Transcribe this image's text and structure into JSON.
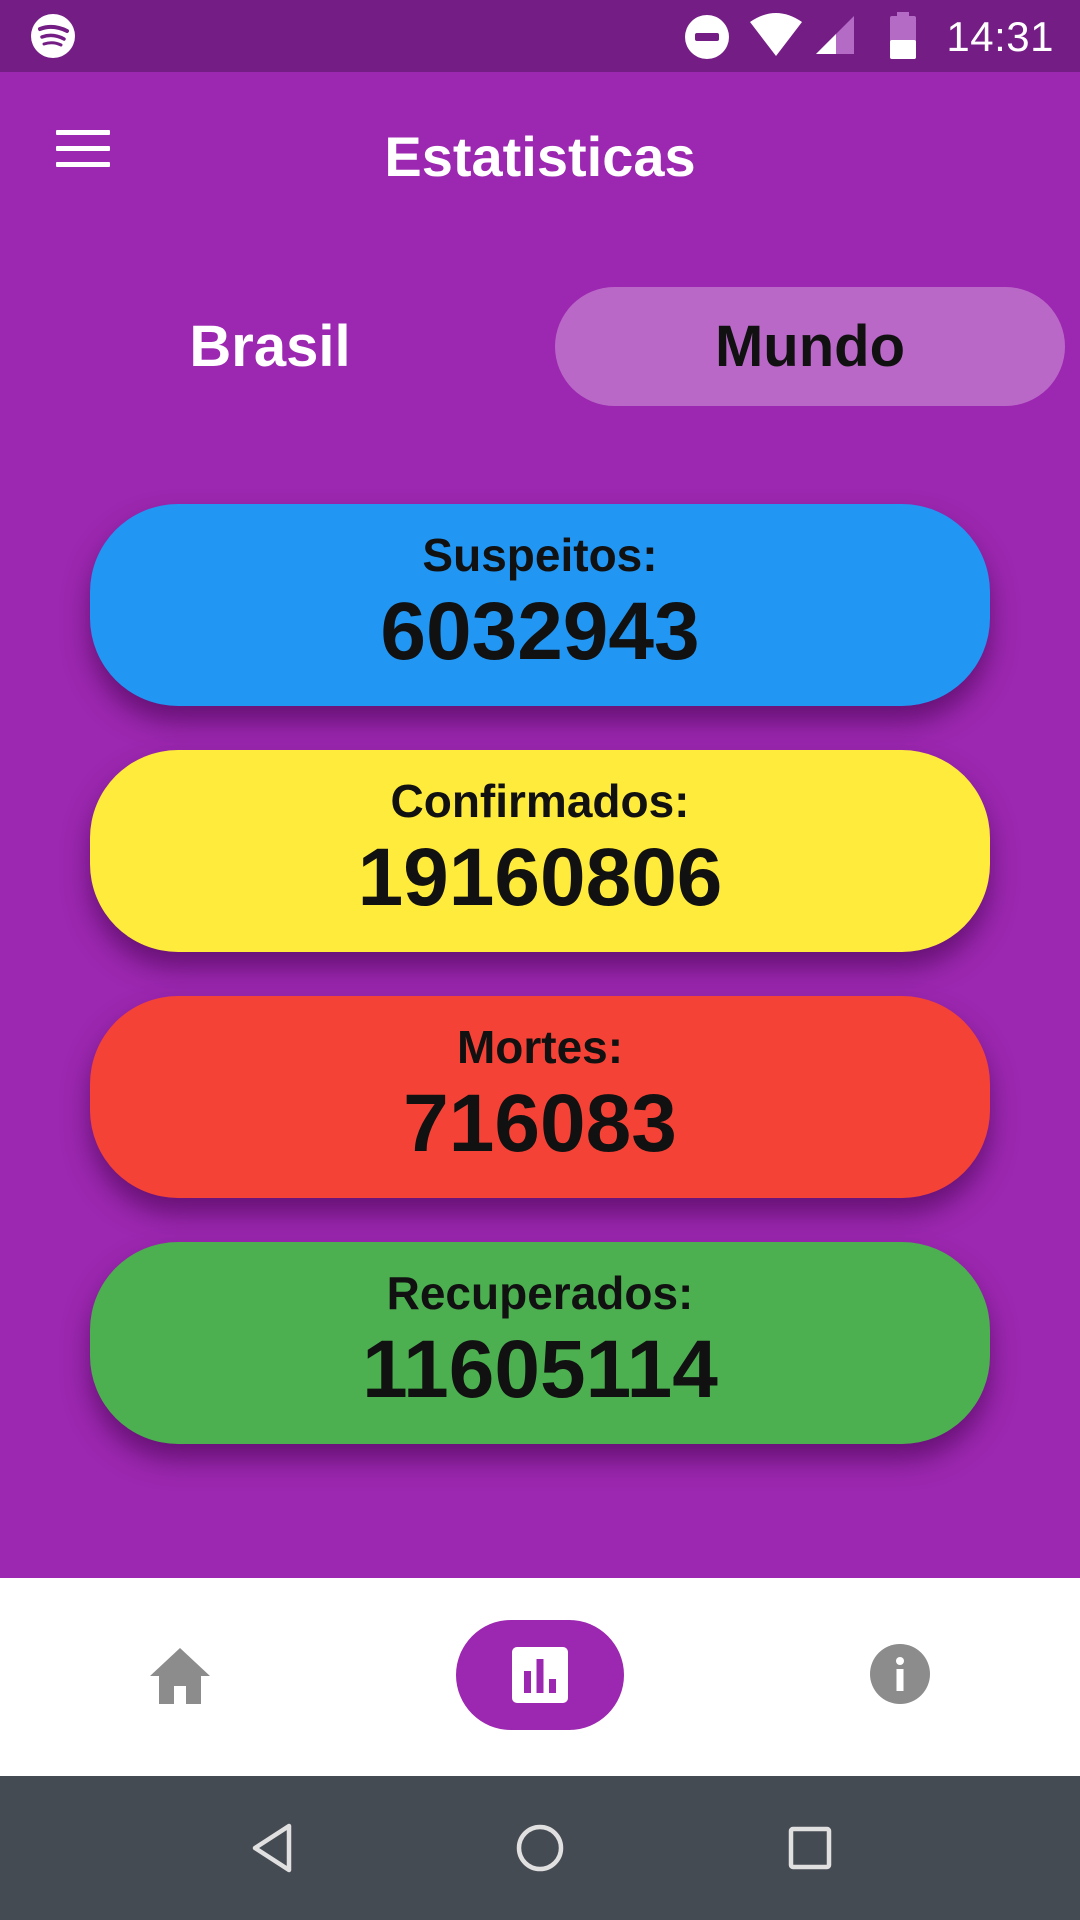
{
  "status_bar": {
    "time": "14:31",
    "icons": [
      "spotify-icon",
      "do-not-disturb-icon",
      "wifi-icon",
      "cell-signal-icon",
      "battery-icon"
    ]
  },
  "header": {
    "title": "Estatisticas",
    "menu_icon": "menu-icon"
  },
  "tabs": [
    {
      "label": "Brasil",
      "selected": false
    },
    {
      "label": "Mundo",
      "selected": true
    }
  ],
  "stats": [
    {
      "label": "Suspeitos:",
      "value": "6032943",
      "color": "#2196f3"
    },
    {
      "label": "Confirmados:",
      "value": "19160806",
      "color": "#ffeb3b"
    },
    {
      "label": "Mortes:",
      "value": "716083",
      "color": "#f44336"
    },
    {
      "label": "Recuperados:",
      "value": "11605114",
      "color": "#4caf50"
    }
  ],
  "bottom_nav": {
    "items": [
      {
        "icon": "home-icon",
        "active": false
      },
      {
        "icon": "bar-chart-icon",
        "active": true
      },
      {
        "icon": "info-icon",
        "active": false
      }
    ]
  },
  "system_nav": {
    "icons": [
      "back-icon",
      "home-circle-icon",
      "recents-icon"
    ]
  },
  "colors": {
    "primary": "#9c27b0",
    "status_bar": "#741d85",
    "tab_selected": "#ba68c8",
    "system_nav": "#454b52"
  }
}
